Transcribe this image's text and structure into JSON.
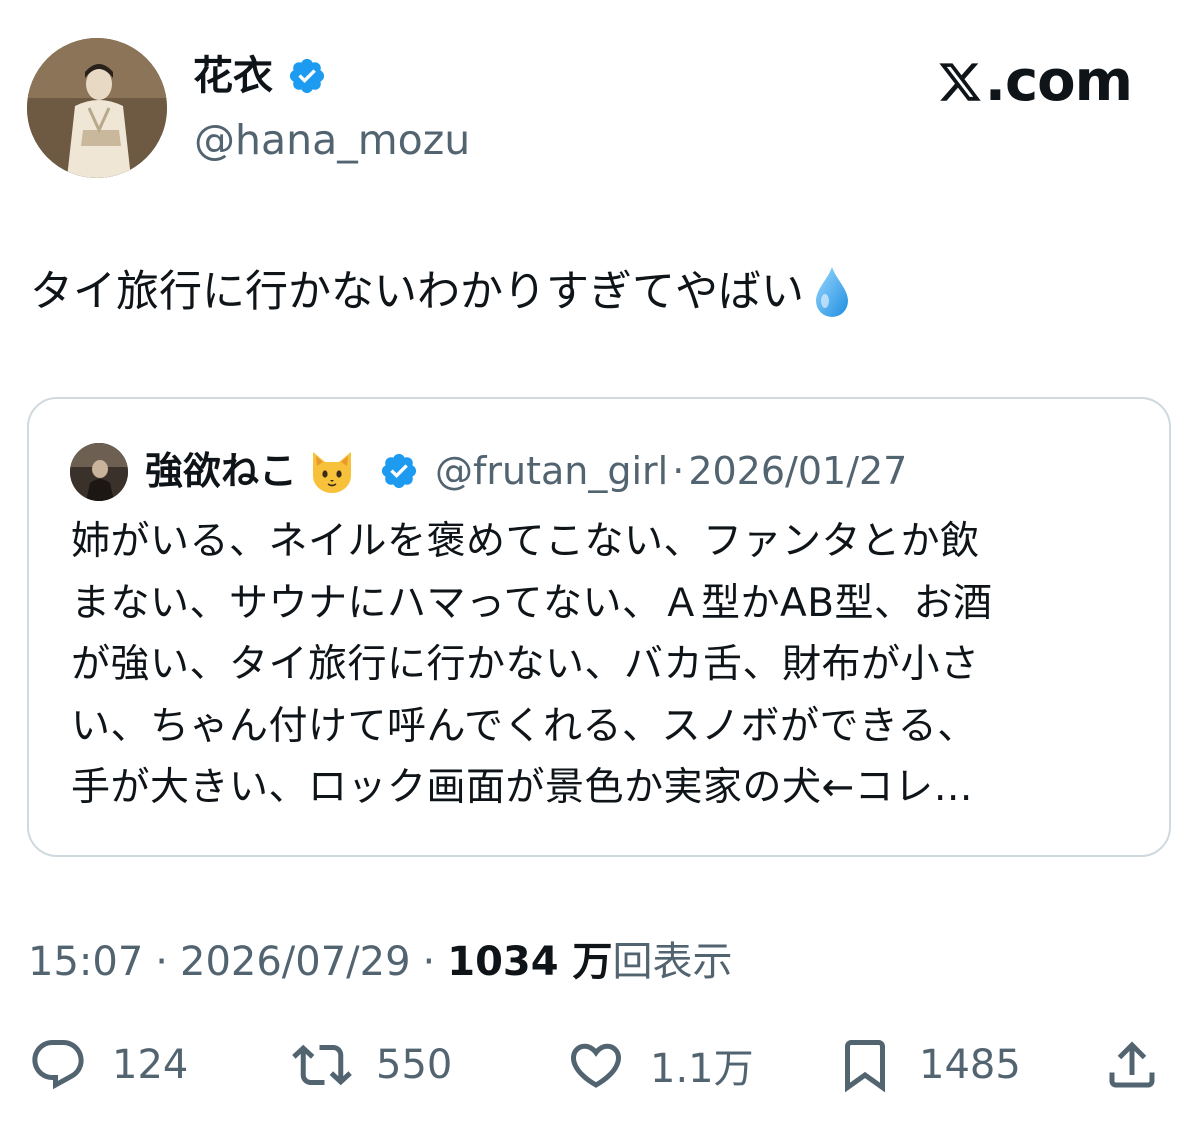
{
  "header": {
    "display_name": "花衣",
    "handle": "@hana_mozu",
    "site_label": ".com"
  },
  "tweet": {
    "text": "タイ旅行に行かないわかりすぎてやばい",
    "emoji": "droplet-emoji"
  },
  "quote": {
    "display_name": "強欲ねこ",
    "emoji": "cat-face-emoji",
    "handle": "@frutan_girl",
    "separator": "·",
    "date": "2026/01/27",
    "lines": [
      "姉がいる、ネイルを褒めてこない、ファンタとか飲",
      "まない、サウナにハマってない、Ａ型かAB型、お酒",
      "が強い、タイ旅行に行かない、バカ舌、財布が小さ",
      "い、ちゃん付けて呼んでくれる、スノボができる、",
      "手が大きい、ロック画面が景色か実家の犬←コレ…"
    ]
  },
  "meta": {
    "time": "15:07",
    "separator": "·",
    "date": "2026/07/29",
    "views_count": "1034 万",
    "views_label": "回表示"
  },
  "actions": {
    "reply_count": "124",
    "retweet_count": "550",
    "like_count": "1.1万",
    "bookmark_count": "1485"
  },
  "colors": {
    "text": "#0f1419",
    "secondary": "#536471",
    "verified": "#1d9bf0",
    "border": "#cfd9de"
  }
}
